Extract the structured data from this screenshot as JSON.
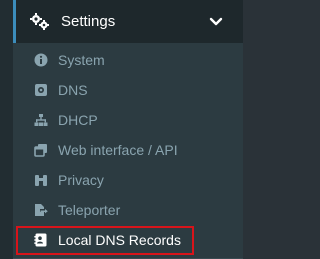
{
  "header": {
    "label": "Settings",
    "icon": "gears-icon",
    "expand_icon": "chevron-down-icon"
  },
  "menu": {
    "items": [
      {
        "label": "System",
        "icon": "info-circle-icon"
      },
      {
        "label": "DNS",
        "icon": "dns-icon"
      },
      {
        "label": "DHCP",
        "icon": "sitemap-icon"
      },
      {
        "label": "Web interface / API",
        "icon": "web-interface-icon"
      },
      {
        "label": "Privacy",
        "icon": "binoculars-icon"
      },
      {
        "label": "Teleporter",
        "icon": "file-export-icon"
      },
      {
        "label": "Local DNS Records",
        "icon": "address-card-icon",
        "active": true
      }
    ]
  },
  "colors": {
    "sidebar_bg": "#2c3b41",
    "header_bg": "#1e282c",
    "menu_text": "#8aa4af",
    "active_text": "#ffffff",
    "accent": "#3c8dbc",
    "highlight_border": "#d8141a"
  }
}
